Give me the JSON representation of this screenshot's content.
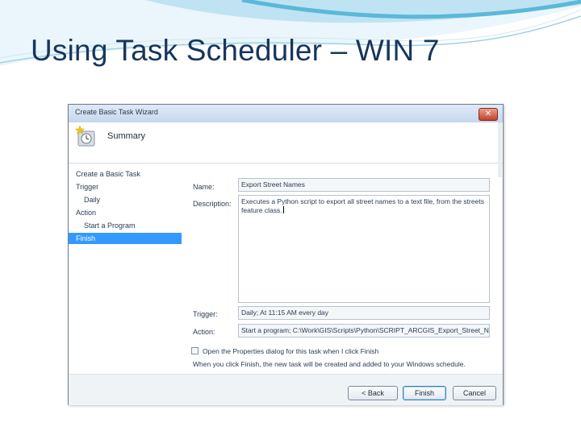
{
  "slide": {
    "title": "Using Task Scheduler – WIN 7"
  },
  "colors": {
    "title": "#17365d",
    "swoosh_light": "#bfe3f2",
    "swoosh_dark": "#5bb8d9",
    "selection": "#3399ff"
  },
  "dialog": {
    "window_title": "Create Basic Task Wizard",
    "close_glyph": "✕",
    "header_title": "Summary",
    "header_icon": "task-wizard-icon",
    "steps": [
      {
        "label": "Create a Basic Task",
        "sub": false,
        "active": false
      },
      {
        "label": "Trigger",
        "sub": false,
        "active": false
      },
      {
        "label": "Daily",
        "sub": true,
        "active": false
      },
      {
        "label": "Action",
        "sub": false,
        "active": false
      },
      {
        "label": "Start a Program",
        "sub": true,
        "active": false
      },
      {
        "label": "Finish",
        "sub": false,
        "active": true
      }
    ],
    "name_label": "Name:",
    "name_value": "Export Street Names",
    "description_label": "Description:",
    "description_value": "Executes a Python script to export all street names to a text file, from the streets feature class.",
    "trigger_label": "Trigger:",
    "trigger_value": "Daily; At 11:15 AM every day",
    "action_label": "Action:",
    "action_value": "Start a program; C:\\Work\\GIS\\Scripts\\Python\\SCRIPT_ARCGIS_Export_Street_N",
    "open_properties_label": "Open the Properties dialog for this task when I click Finish",
    "info_text": "When you click Finish, the new task will be created and added to your Windows schedule.",
    "back_label": "< Back",
    "finish_label": "Finish",
    "cancel_label": "Cancel"
  }
}
